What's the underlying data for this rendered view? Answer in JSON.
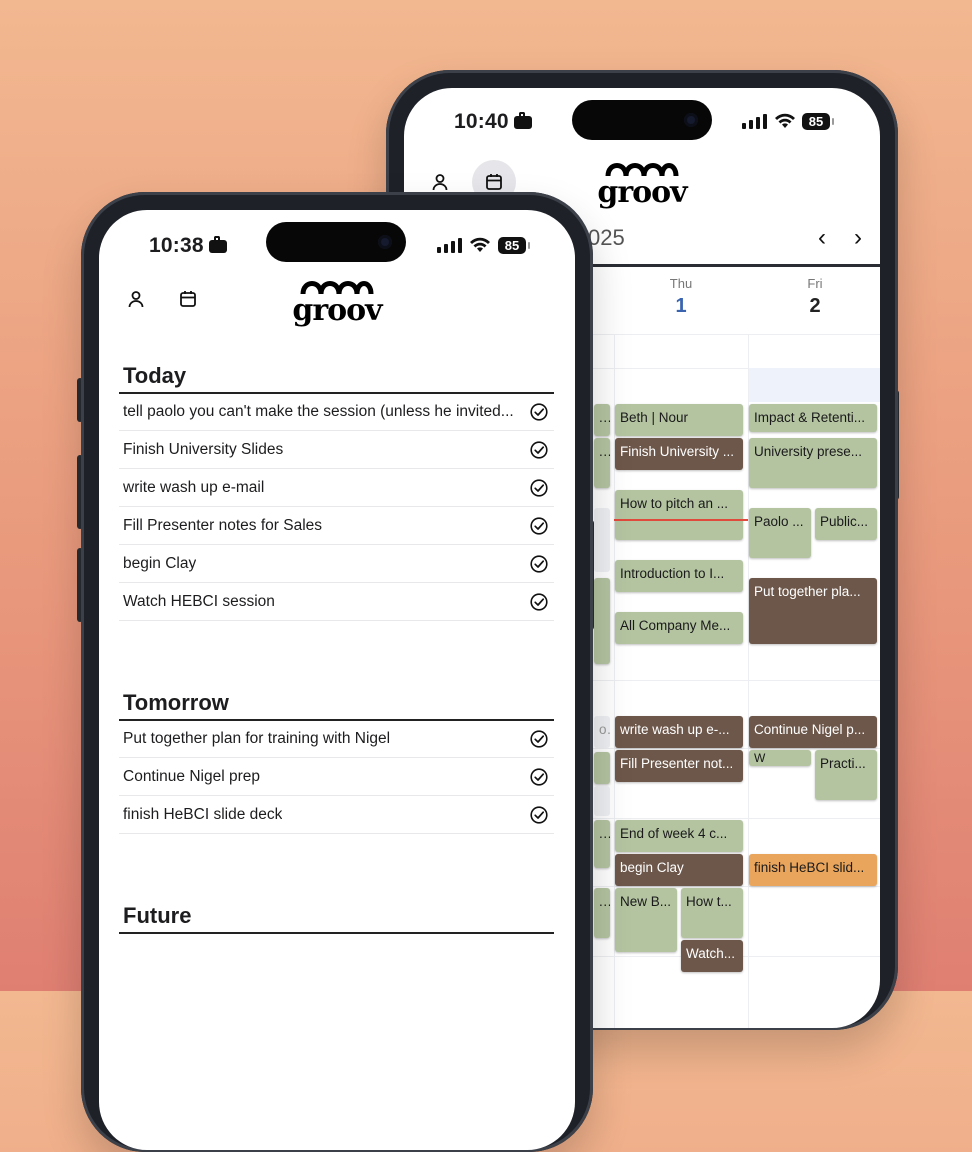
{
  "back_phone": {
    "status": {
      "time": "10:40",
      "battery": "85"
    },
    "header": {
      "logo": "groov",
      "profile_icon": "person-icon",
      "calendar_icon": "calendar-icon"
    },
    "calendar": {
      "month_label_partial": "025",
      "nav": {
        "prev": "‹",
        "next": "›"
      },
      "days": [
        {
          "dow": "Thu",
          "date": "1"
        },
        {
          "dow": "Fri",
          "date": "2"
        }
      ],
      "events": {
        "thu": [
          "Beth | Nour",
          "Finish University ...",
          "How to pitch an ...",
          "Introduction to I...",
          "All Company Me...",
          "write wash up e-...",
          "Fill Presenter not...",
          "End of week 4 c...",
          "begin Clay",
          "New B...",
          "How t...",
          "Watch..."
        ],
        "fri": [
          "Impact & Retenti...",
          "University prese...",
          "Paolo ...",
          "Public...",
          "Put together pla...",
          "Continue Nigel p...",
          "W",
          "Practi...",
          "finish HeBCI slid..."
        ],
        "partial_left": [
          "...",
          "...",
          "...",
          "o",
          "...",
          "..."
        ]
      }
    }
  },
  "front_phone": {
    "status": {
      "time": "10:38",
      "battery": "85"
    },
    "header": {
      "logo": "groov",
      "profile_icon": "person-icon",
      "calendar_icon": "calendar-icon"
    },
    "sections": [
      {
        "title": "Today",
        "tasks": [
          "tell paolo you can't make the session (unless he invited...",
          "Finish University Slides",
          "write wash up e-mail",
          "Fill Presenter notes for Sales",
          "begin Clay",
          "Watch HEBCI session"
        ]
      },
      {
        "title": "Tomorrow",
        "tasks": [
          "Put together plan for training with Nigel",
          "Continue Nigel prep",
          "finish HeBCI slide deck"
        ]
      },
      {
        "title": "Future",
        "tasks": []
      }
    ]
  },
  "colors": {
    "event_green": "#b4c4a1",
    "event_brown": "#6d574a",
    "event_orange": "#e9a55c",
    "now_line": "#e04a3c",
    "accent_blue": "#3a64b0"
  }
}
